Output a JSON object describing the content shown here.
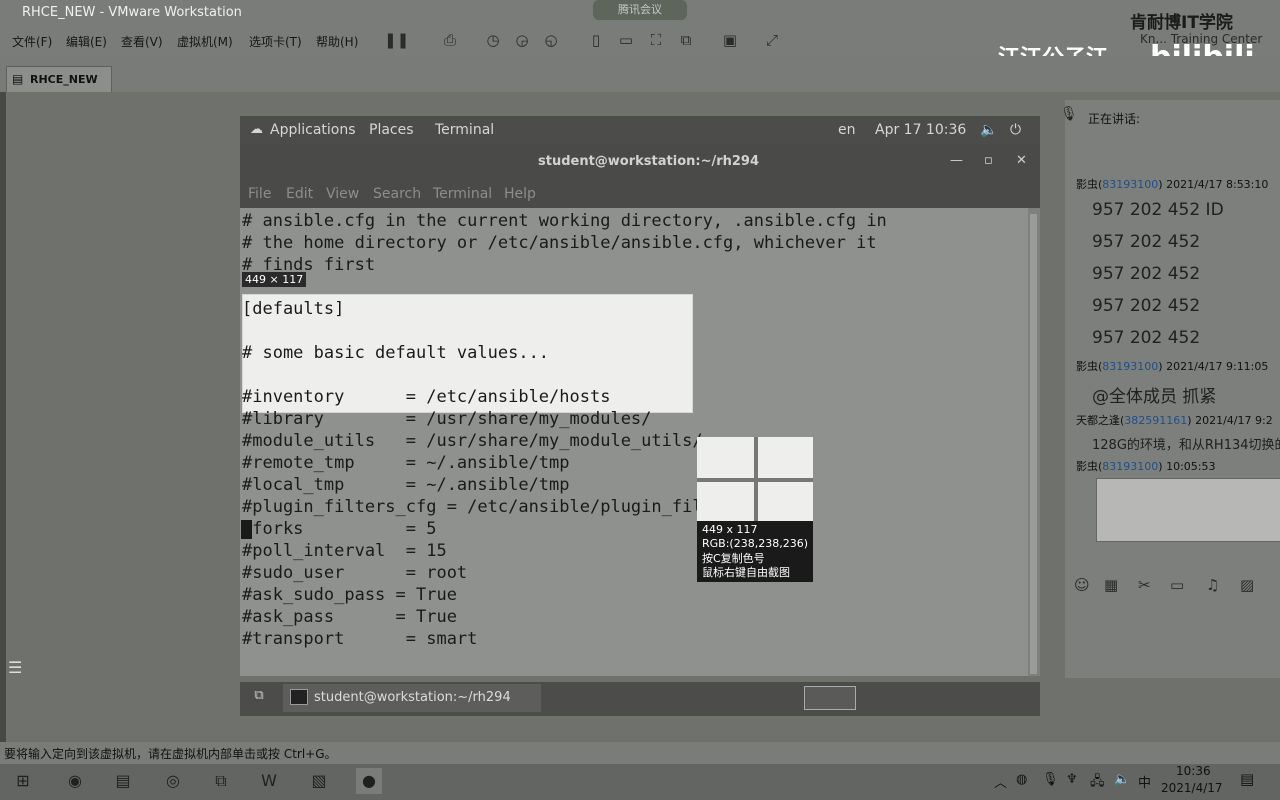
{
  "vmware": {
    "title": "RHCE_NEW - VMware Workstation",
    "menu": [
      "文件(F)",
      "编辑(E)",
      "查看(V)",
      "虚拟机(M)",
      "选项卡(T)",
      "帮助(H)"
    ],
    "tab_label": "RHCE_NEW",
    "status_text": "要将输入定向到该虚拟机，请在虚拟机内部单击或按 Ctrl+G。"
  },
  "gnome": {
    "applications": "Applications",
    "places": "Places",
    "terminal": "Terminal",
    "lang": "en",
    "clock": "Apr 17  10:36"
  },
  "terminal": {
    "window_title": "student@workstation:~/rh294",
    "menu": [
      "File",
      "Edit",
      "View",
      "Search",
      "Terminal",
      "Help"
    ],
    "lines": [
      "# ansible.cfg in the current working directory, .ansible.cfg in",
      "# the home directory or /etc/ansible/ansible.cfg, whichever it",
      "# finds first",
      "",
      "[defaults]",
      "",
      "# some basic default values...",
      "",
      "#inventory      = /etc/ansible/hosts",
      "#library        = /usr/share/my_modules/",
      "#module_utils   = /usr/share/my_module_utils/",
      "#remote_tmp     = ~/.ansible/tmp",
      "#local_tmp      = ~/.ansible/tmp",
      "#plugin_filters_cfg = /etc/ansible/plugin_filters.yml",
      "#forks          = 5",
      "#poll_interval  = 15",
      "#sudo_user      = root",
      "#ask_sudo_pass = True",
      "#ask_pass      = True",
      "#transport      = smart"
    ],
    "taskbar_item": "student@workstation:~/rh294"
  },
  "screenshot_tool": {
    "size_label": "449 × 117",
    "mag_size": "449 x 117",
    "mag_rgb": "RGB:(238,238,236)",
    "mag_copy": "按C复制色号",
    "mag_free": "鼠标右键自由截图"
  },
  "chat": {
    "speaking": "正在讲话:",
    "messages": [
      {
        "user": "影虫(",
        "uid": "83193100",
        "time": ") 2021/4/17 8:53:10"
      },
      {
        "text": "957 202 452 ID"
      },
      {
        "text": "957 202 452"
      },
      {
        "text": "957 202 452"
      },
      {
        "text": "957 202 452"
      },
      {
        "text": "957 202 452"
      },
      {
        "user": "影虫(",
        "uid": "83193100",
        "time": ") 2021/4/17 9:11:05"
      },
      {
        "text": "@全体成员 抓紧"
      },
      {
        "user": "天都之逢(",
        "uid": "382591161",
        "time": ") 2021/4/17 9:2"
      },
      {
        "text": "128G的环境，和从RH134切换的"
      },
      {
        "user": "影虫(",
        "uid": "83193100",
        "time": ") 10:05:53"
      }
    ]
  },
  "watermark": {
    "author": "江江公子江",
    "bili": "bilibili",
    "school": "肯耐博IT学院",
    "school_sub": "Kn... Training Center",
    "meeting": "腾讯会议"
  },
  "clock": {
    "time": "10:36",
    "date": "2021/4/17"
  },
  "ime": "中"
}
